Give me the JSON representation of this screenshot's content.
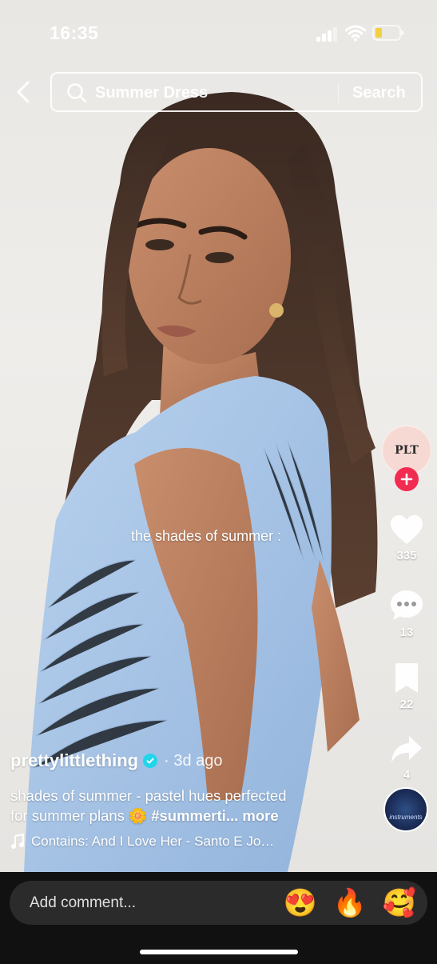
{
  "status_bar": {
    "time": "16:35",
    "battery_color": "#f4d03f"
  },
  "search": {
    "query": "Summer Dress",
    "button_label": "Search"
  },
  "video": {
    "overlay_text": "the shades of summer :"
  },
  "creator": {
    "avatar_text": "PLT",
    "username": "prettylittlething",
    "posted": "· 3d ago"
  },
  "actions": {
    "likes": "335",
    "comments": "13",
    "saves": "22",
    "shares": "4"
  },
  "caption": {
    "line1": "shades of summer - pastel hues perfected",
    "line2_prefix": "for summer plans",
    "emoji": "🌼",
    "hashtag": "#summerti",
    "more": "... more"
  },
  "music": {
    "label": "Contains: And I Love Her - Santo E Jo…",
    "disc_label": "instruments"
  },
  "comment_bar": {
    "placeholder": "Add comment...",
    "emojis": [
      "😍",
      "🔥",
      "🥰"
    ]
  },
  "colors": {
    "accent": "#f12b51",
    "verified": "#20d5ec",
    "dress": "#a9c6e8"
  }
}
